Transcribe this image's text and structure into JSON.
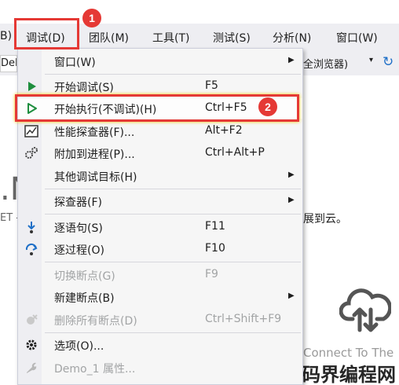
{
  "menubar": {
    "items": [
      "B)",
      "调试(D)",
      "团队(M)",
      "工具(T)",
      "测试(S)",
      "分析(N)",
      "窗口(W)"
    ]
  },
  "toolbar": {
    "left_text": "Del",
    "browser_text": "全浏览器)",
    "dropdown_arrow": "▾"
  },
  "background": {
    "big_text": ".N",
    "et_text": "ET -",
    "cloud_text": "展到云。",
    "connect_text": "Connect To The",
    "watermark": "码界编程网"
  },
  "annotations": {
    "badge1": "1",
    "badge2": "2"
  },
  "menu": {
    "items": [
      {
        "label": "窗口(W)",
        "shortcut": "",
        "submenu": true
      },
      {
        "label": "开始调试(S)",
        "shortcut": "F5",
        "submenu": false
      },
      {
        "label": "开始执行(不调试)(H)",
        "shortcut": "Ctrl+F5",
        "submenu": false
      },
      {
        "label": "性能探查器(F)...",
        "shortcut": "Alt+F2",
        "submenu": false
      },
      {
        "label": "附加到进程(P)...",
        "shortcut": "Ctrl+Alt+P",
        "submenu": false
      },
      {
        "label": "其他调试目标(H)",
        "shortcut": "",
        "submenu": true
      },
      {
        "label": "探查器(F)",
        "shortcut": "",
        "submenu": true
      },
      {
        "label": "逐语句(S)",
        "shortcut": "F11",
        "submenu": false
      },
      {
        "label": "逐过程(O)",
        "shortcut": "F10",
        "submenu": false
      },
      {
        "label": "切换断点(G)",
        "shortcut": "F9",
        "submenu": false
      },
      {
        "label": "新建断点(B)",
        "shortcut": "",
        "submenu": true
      },
      {
        "label": "删除所有断点(D)",
        "shortcut": "Ctrl+Shift+F9",
        "submenu": false
      },
      {
        "label": "选项(O)...",
        "shortcut": "",
        "submenu": false
      },
      {
        "label": "Demo_1 属性...",
        "shortcut": "",
        "submenu": false
      }
    ],
    "submenu_arrow": "▶"
  },
  "colors": {
    "accent_red": "#e53935",
    "play_green": "#1e8e3e",
    "refresh_blue": "#1e6fc7"
  }
}
